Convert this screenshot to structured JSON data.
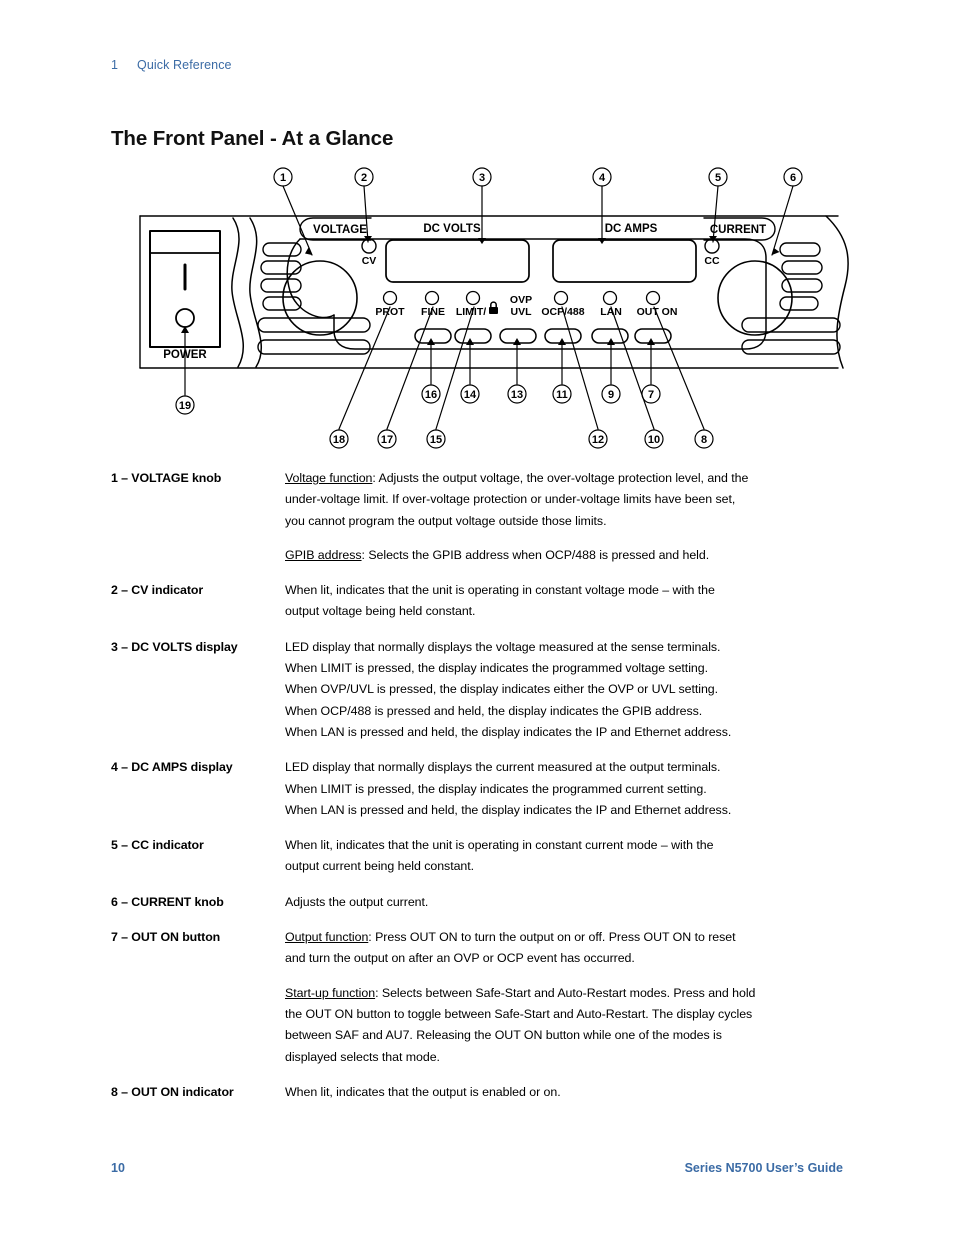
{
  "header": {
    "chapter_number": "1",
    "chapter_title": "Quick Reference"
  },
  "title": "The Front Panel - At a Glance",
  "colors": {
    "accent_blue": "#3b6ba5",
    "ink": "#000000",
    "paper": "#ffffff"
  },
  "figure": {
    "name": "front-panel-diagram",
    "panel_labels": {
      "power": "POWER",
      "power_switch_on_mark": "I",
      "voltage": "VOLTAGE",
      "current": "CURRENT",
      "dc_volts": "DC VOLTS",
      "dc_amps": "DC AMPS",
      "cv": "CV",
      "cc": "CC"
    },
    "buttons": [
      {
        "id": "prot",
        "label": "PROT",
        "label2": "",
        "has_led": true,
        "has_lock_icon": false
      },
      {
        "id": "fine",
        "label": "FINE",
        "label2": "",
        "has_led": true,
        "has_lock_icon": false
      },
      {
        "id": "limit",
        "label": "LIMIT/",
        "label2": "",
        "has_led": true,
        "has_lock_icon": true
      },
      {
        "id": "ovpuvl",
        "label": "OVP",
        "label2": "UVL",
        "has_led": false,
        "has_lock_icon": false
      },
      {
        "id": "ocp488",
        "label": "OCP/488",
        "label2": "",
        "has_led": true,
        "has_lock_icon": false
      },
      {
        "id": "lan",
        "label": "LAN",
        "label2": "",
        "has_led": true,
        "has_lock_icon": false
      },
      {
        "id": "outon",
        "label": "OUT ON",
        "label2": "",
        "has_led": true,
        "has_lock_icon": false
      }
    ],
    "callouts_top": [
      "1",
      "2",
      "3",
      "4",
      "5",
      "6"
    ],
    "callouts_lower_row1": [
      "16",
      "14",
      "13",
      "11",
      "9",
      "7"
    ],
    "callouts_lower_row2": [
      "18",
      "17",
      "15",
      "12",
      "10",
      "8"
    ],
    "callout_power": "19"
  },
  "definitions": [
    {
      "number": "1",
      "term": "VOLTAGE knob",
      "paragraphs": [
        {
          "lead": "Voltage function",
          "lines": [
            ": Adjusts the output voltage, the over-voltage protection level, and the",
            "under-voltage limit. If over-voltage protection or under-voltage limits have been set,",
            "you cannot program the output voltage outside those limits."
          ]
        },
        {
          "lead": "GPIB address",
          "lines": [
            ": Selects the GPIB address when OCP/488 is pressed and held."
          ]
        }
      ]
    },
    {
      "number": "2",
      "term": "CV indicator",
      "paragraphs": [
        {
          "lead": "",
          "lines": [
            "When lit, indicates that the unit is operating in constant voltage mode – with the",
            "output voltage being held constant."
          ]
        }
      ]
    },
    {
      "number": "3",
      "term": "DC VOLTS display",
      "paragraphs": [
        {
          "lead": "",
          "lines": [
            "LED display that normally displays the voltage measured at the sense terminals.",
            "When LIMIT is pressed, the display indicates the programmed voltage setting.",
            "When OVP/UVL is pressed, the display indicates either the OVP or UVL setting.",
            "When OCP/488 is pressed and held, the display indicates the GPIB address.",
            "When LAN is pressed and held, the display indicates the IP and Ethernet address."
          ]
        }
      ]
    },
    {
      "number": "4",
      "term": "DC AMPS display",
      "paragraphs": [
        {
          "lead": "",
          "lines": [
            "LED display that normally displays the current measured at the output terminals.",
            "When LIMIT is pressed, the display indicates the programmed current setting.",
            "When LAN is pressed and held, the display indicates the IP and Ethernet address."
          ]
        }
      ]
    },
    {
      "number": "5",
      "term": "CC indicator",
      "paragraphs": [
        {
          "lead": "",
          "lines": [
            "When lit, indicates that the unit is operating in constant current mode – with the",
            "output current being held constant."
          ]
        }
      ]
    },
    {
      "number": "6",
      "term": "CURRENT knob",
      "paragraphs": [
        {
          "lead": "",
          "lines": [
            "Adjusts the output current."
          ]
        }
      ]
    },
    {
      "number": "7",
      "term": "OUT ON button",
      "paragraphs": [
        {
          "lead": "Output function",
          "lines": [
            ": Press OUT ON to turn the output on or off. Press OUT ON to reset",
            "and turn the output on after an OVP or OCP event has occurred."
          ]
        },
        {
          "lead": "Start-up function",
          "lines": [
            ": Selects between Safe-Start and Auto-Restart modes. Press and hold",
            "the OUT ON button to toggle between Safe-Start and Auto-Restart. The display cycles",
            "between SAF and AU7. Releasing the OUT ON button while one of the modes is",
            "displayed selects that mode."
          ]
        }
      ]
    },
    {
      "number": "8",
      "term": "OUT ON indicator",
      "paragraphs": [
        {
          "lead": "",
          "lines": [
            "When lit, indicates that the output is enabled or on."
          ]
        }
      ]
    }
  ],
  "footer": {
    "page_number": "10",
    "guide_title": "Series N5700 User’s Guide"
  }
}
